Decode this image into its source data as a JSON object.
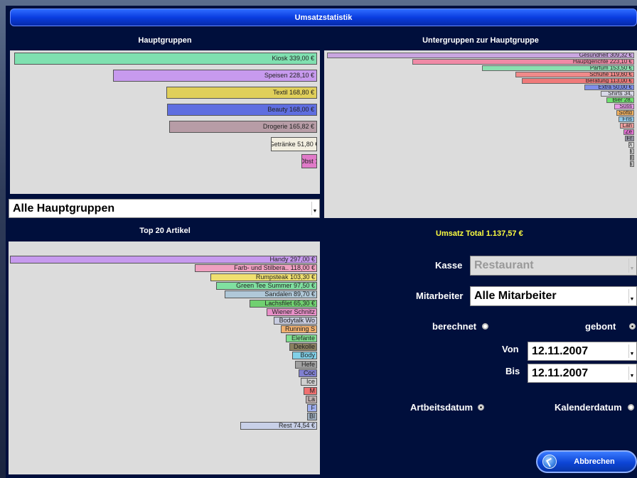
{
  "window_title": "Umsatzstatistik",
  "hauptgruppen": {
    "title": "Hauptgruppen",
    "bars": [
      {
        "label": "Kiosk 339,00 €",
        "value": 339.0,
        "color": "#7fe0b0"
      },
      {
        "label": "Speisen 228,10 €",
        "value": 228.1,
        "color": "#c79aee"
      },
      {
        "label": "Textil 168,80 €",
        "value": 168.8,
        "color": "#e0cf5a"
      },
      {
        "label": "Beauty 168,00 €",
        "value": 168.0,
        "color": "#5f6ee0"
      },
      {
        "label": "Drogerie 165,82 €",
        "value": 165.82,
        "color": "#b79ca6"
      },
      {
        "label": "Getränke 51,80 €",
        "value": 51.8,
        "color": "#f2eee0"
      },
      {
        "label": "Obst 1",
        "value": 14.0,
        "color": "#e07ac8"
      }
    ],
    "select_value": "Alle Hauptgruppen"
  },
  "untergruppen": {
    "title": "Untergruppen zur Hauptgruppe",
    "bars": [
      {
        "label": "Gesundheit 309,32 €",
        "value": 309.32,
        "color": "#c9a6e0"
      },
      {
        "label": "Hauptgerichte 223,10 €",
        "value": 223.1,
        "color": "#f08aa6"
      },
      {
        "label": "Parfüm 153,50 €",
        "value": 153.5,
        "color": "#8ae0b0"
      },
      {
        "label": "Schuhe 119,60 €",
        "value": 119.6,
        "color": "#f08a8a"
      },
      {
        "label": "Beratung 113,00 €",
        "value": 113.0,
        "color": "#f07a7a"
      },
      {
        "label": "Extra 50,00 €",
        "value": 50.0,
        "color": "#7f8ee8"
      },
      {
        "label": "Shirts 34,",
        "value": 34.0,
        "color": "#d8d8e8"
      },
      {
        "label": "Bier 28,",
        "value": 28.0,
        "color": "#6ee06e"
      },
      {
        "label": "Süss",
        "value": 20.0,
        "color": "#e89ae8"
      },
      {
        "label": "Softd",
        "value": 18.0,
        "color": "#f0b060"
      },
      {
        "label": "Fris",
        "value": 16.0,
        "color": "#90c8e8"
      },
      {
        "label": "Lan",
        "value": 14.0,
        "color": "#f0a0a0"
      },
      {
        "label": "Ze",
        "value": 11.0,
        "color": "#e070d0"
      },
      {
        "label": "Fr",
        "value": 9.0,
        "color": "#9090a0"
      },
      {
        "label": "Di",
        "value": 6.0,
        "color": "#e0e0e0"
      },
      {
        "label": "a",
        "value": 3.0,
        "color": "#c0c0c0"
      },
      {
        "label": "I",
        "value": 3.0,
        "color": "#a0a0a0"
      },
      {
        "label": "a",
        "value": 3.0,
        "color": "#c0c0c0"
      }
    ]
  },
  "top20": {
    "title": "Top 20 Artikel",
    "bars": [
      {
        "label": "Handy 297,00 €",
        "value": 297.0,
        "color": "#c79aee"
      },
      {
        "label": "Farb- und Stilbera.. 118,00 €",
        "value": 118.0,
        "color": "#f0a0c0"
      },
      {
        "label": "Rumpsteak 103,30 €",
        "value": 103.3,
        "color": "#f0e070"
      },
      {
        "label": "Green Tee Summer 97,50 €",
        "value": 97.5,
        "color": "#80e0a0"
      },
      {
        "label": "Sandalen 89,70 €",
        "value": 89.7,
        "color": "#b0c8d8"
      },
      {
        "label": "Lachsfilet 65,30 €",
        "value": 65.3,
        "color": "#70d070"
      },
      {
        "label": "Wiener Schnitz",
        "value": 49.0,
        "color": "#e890c8"
      },
      {
        "label": "Bodytalk Wo",
        "value": 42.0,
        "color": "#c8cce0"
      },
      {
        "label": "Running S",
        "value": 35.0,
        "color": "#f0b070"
      },
      {
        "label": "Elefante",
        "value": 30.0,
        "color": "#80e090"
      },
      {
        "label": "Dekolle",
        "value": 27.0,
        "color": "#8a8060"
      },
      {
        "label": "Body",
        "value": 24.0,
        "color": "#80d0e8"
      },
      {
        "label": "Hefe",
        "value": 21.0,
        "color": "#a0a0a0"
      },
      {
        "label": "Coc",
        "value": 18.0,
        "color": "#8080d0"
      },
      {
        "label": "Ice",
        "value": 16.0,
        "color": "#d0d0d0"
      },
      {
        "label": "M",
        "value": 13.0,
        "color": "#f07070"
      },
      {
        "label": "La",
        "value": 11.0,
        "color": "#c0b0b0"
      },
      {
        "label": "F",
        "value": 9.0,
        "color": "#a0b0f0"
      },
      {
        "label": "Bl",
        "value": 9.0,
        "color": "#a0b0c0"
      },
      {
        "label": "Rest 74,54 €",
        "value": 74.54,
        "color": "#c8d0e8"
      }
    ]
  },
  "filters": {
    "total_label": "Umsatz Total 1.137,57 €",
    "kasse_label": "Kasse",
    "kasse_value": "Restaurant",
    "mitarbeiter_label": "Mitarbeiter",
    "mitarbeiter_value": "Alle Mitarbeiter",
    "berechnet_label": "berechnet",
    "gebont_label": "gebont",
    "von_label": "Von",
    "von_value": "12.11.2007",
    "bis_label": "Bis",
    "bis_value": "12.11.2007",
    "arbeitsdatum_label": "Artbeitsdatum",
    "kalenderdatum_label": "Kalenderdatum",
    "berechnet_selected": false,
    "gebont_selected": true,
    "arbeitsdatum_selected": true,
    "kalenderdatum_selected": false
  },
  "cancel_button_label": "Abbrechen",
  "arrow_glyph": "▼"
}
